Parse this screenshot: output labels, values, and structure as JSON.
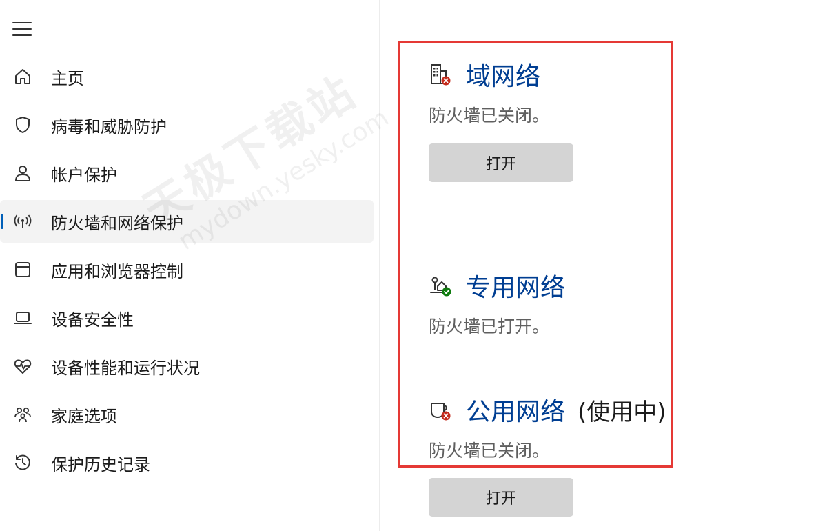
{
  "sidebar": {
    "menu_icon": "hamburger-menu-icon",
    "items": [
      {
        "label": "主页",
        "icon": "home-icon"
      },
      {
        "label": "病毒和威胁防护",
        "icon": "shield-icon"
      },
      {
        "label": "帐户保护",
        "icon": "person-icon"
      },
      {
        "label": "防火墙和网络保护",
        "icon": "wifi-antenna-icon",
        "active": true
      },
      {
        "label": "应用和浏览器控制",
        "icon": "browser-window-icon"
      },
      {
        "label": "设备安全性",
        "icon": "laptop-icon"
      },
      {
        "label": "设备性能和运行状况",
        "icon": "heart-pulse-icon"
      },
      {
        "label": "家庭选项",
        "icon": "family-icon"
      },
      {
        "label": "保护历史记录",
        "icon": "history-icon"
      }
    ]
  },
  "watermark": {
    "text": "天极下载站",
    "url": "mydown.yesky.com"
  },
  "networks": {
    "domain": {
      "title": "域网络",
      "status": "防火墙已关闭。",
      "button": "打开",
      "icon": "domain-network-error-icon"
    },
    "private": {
      "title": "专用网络",
      "status": "防火墙已打开。",
      "icon": "private-network-ok-icon"
    },
    "public": {
      "title": "公用网络",
      "suffix": "(使用中)",
      "status": "防火墙已关闭。",
      "button": "打开",
      "icon": "public-network-error-icon"
    }
  },
  "colors": {
    "accent": "#005fb8",
    "link": "#003e92",
    "highlight_border": "#e53935",
    "error": "#c42b1c",
    "ok": "#0f7b0f"
  }
}
